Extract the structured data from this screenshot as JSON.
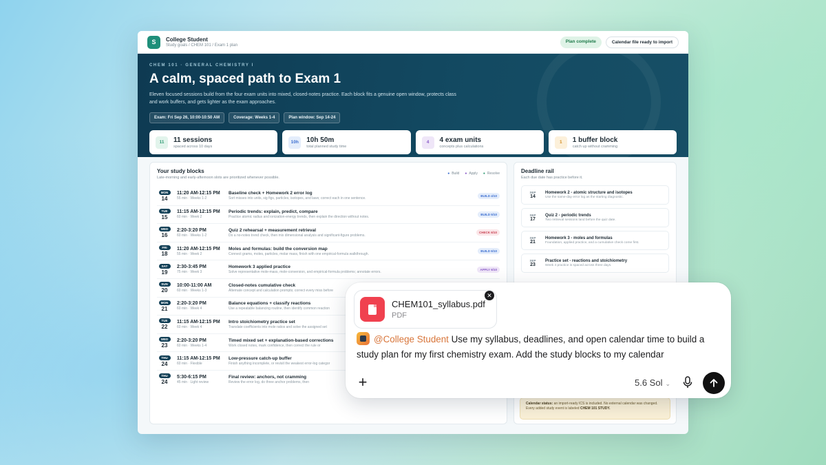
{
  "app": {
    "logo_letter": "S",
    "name": "College Student",
    "breadcrumb": "Study goals / CHEM 101 / Exam 1 plan",
    "status_pill": "Plan complete",
    "calendar_pill": "Calendar file ready to import"
  },
  "hero": {
    "eyebrow": "CHEM 101 · GENERAL CHEMISTRY I",
    "title": "A calm, spaced path to Exam 1",
    "description": "Eleven focused sessions build from the four exam units into mixed, closed-notes practice. Each block fits a genuine open window, protects class and work buffers, and gets lighter as the exam approaches.",
    "chips": [
      "Exam: Fri Sep 26, 10:00-10:50 AM",
      "Coverage: Weeks 1-4",
      "Plan window: Sep 14-24"
    ]
  },
  "stats": [
    {
      "badge": "11",
      "value": "11 sessions",
      "sub": "spaced across 10 days",
      "color": "#2f9a73",
      "bg": "#e2f4ec"
    },
    {
      "badge": "10h",
      "value": "10h 50m",
      "sub": "total planned study time",
      "color": "#3d6fd0",
      "bg": "#e4edfb"
    },
    {
      "badge": "4",
      "value": "4 exam units",
      "sub": "concepts plus calculations",
      "color": "#8a5cc8",
      "bg": "#efe6f8"
    },
    {
      "badge": "1",
      "value": "1 buffer block",
      "sub": "catch up without cramming",
      "color": "#d28a1e",
      "bg": "#fcf0da"
    }
  ],
  "blocks": {
    "title": "Your study blocks",
    "subtitle": "Late-morning and early-afternoon slots are prioritized whenever possible.",
    "legend": [
      "Build",
      "Apply",
      "Resolve"
    ],
    "rows": [
      {
        "dow": "MON",
        "day": "14",
        "time": "11:20 AM-12:15 PM",
        "meta": "55 min · Weeks 1-2",
        "title": "Baseline check + Homework 2 error log",
        "desc": "Sort misses into units, sig figs, particles, isotopes, and laws; correct each in one sentence.",
        "tag": "BUILD 4/10",
        "tag_kind": "build"
      },
      {
        "dow": "TUE",
        "day": "15",
        "time": "11:15 AM-12:15 PM",
        "meta": "60 min · Week 2",
        "title": "Periodic trends: explain, predict, compare",
        "desc": "Practice atomic radius and ionization-energy trends, then explain the direction without notes.",
        "tag": "BUILD 5/10",
        "tag_kind": "build"
      },
      {
        "dow": "WED",
        "day": "16",
        "time": "2:20-3:20 PM",
        "meta": "60 min · Weeks 1-2",
        "title": "Quiz 2 rehearsal + measurement retrieval",
        "desc": "Do a no-notes trend check, then mix dimensional analysis and significant-figure problems.",
        "tag": "CHECK 6/10",
        "tag_kind": "check"
      },
      {
        "dow": "FRI",
        "day": "18",
        "time": "11:20 AM-12:15 PM",
        "meta": "55 min · Week 2",
        "title": "Moles and formulas: build the conversion map",
        "desc": "Connect grams, moles, particles, molar mass, finish with one empirical-formula walkthrough.",
        "tag": "BUILD 6/10",
        "tag_kind": "build"
      },
      {
        "dow": "SAT",
        "day": "19",
        "time": "2:30-3:45 PM",
        "meta": "75 min · Week 3",
        "title": "Homework 3 applied practice",
        "desc": "Solve representative mole-mass, mole-conversion, and empirical-formula problems; annotate errors.",
        "tag": "APPLY 6/10",
        "tag_kind": "apply"
      },
      {
        "dow": "SUN",
        "day": "20",
        "time": "10:00-11:00 AM",
        "meta": "60 min · Weeks 1-3",
        "title": "Closed-notes cumulative check",
        "desc": "Alternate concept and calculation prompts; correct every miss before",
        "tag": "",
        "tag_kind": ""
      },
      {
        "dow": "MON",
        "day": "21",
        "time": "2:20-3:20 PM",
        "meta": "60 min · Week 4",
        "title": "Balance equations + classify reactions",
        "desc": "Use a repeatable balancing routine, then identify common reaction",
        "tag": "",
        "tag_kind": ""
      },
      {
        "dow": "TUE",
        "day": "22",
        "time": "11:15 AM-12:15 PM",
        "meta": "60 min · Week 4",
        "title": "Intro stoichiometry practice set",
        "desc": "Translate coefficients into mole ratios and solve the assigned set",
        "tag": "",
        "tag_kind": ""
      },
      {
        "dow": "WED",
        "day": "23",
        "time": "2:20-3:20 PM",
        "meta": "60 min · Weeks 1-4",
        "title": "Timed mixed set + explanation-based corrections",
        "desc": "Work closed notes, mark confidence, then correct the rule or",
        "tag": "",
        "tag_kind": ""
      },
      {
        "dow": "THU",
        "day": "24",
        "time": "11:15 AM-12:15 PM",
        "meta": "60 min · Flexible",
        "title": "Low-pressure catch-up buffer",
        "desc": "Finish anything incomplete, or revisit the weakest error-log categor",
        "tag": "",
        "tag_kind": ""
      },
      {
        "dow": "THU",
        "day": "24",
        "time": "5:30-6:15 PM",
        "meta": "45 min · Light review",
        "title": "Final review: anchors, not cramming",
        "desc": "Review the error log, do three anchor problems, then",
        "tag": "",
        "tag_kind": ""
      }
    ]
  },
  "rail": {
    "title": "Deadline rail",
    "subtitle": "Each due date has practice before it.",
    "items": [
      {
        "mon": "SEP",
        "day": "14",
        "title": "Homework 2 - atomic structure and isotopes",
        "desc": "Use the same-day error log as the starting diagnostic."
      },
      {
        "mon": "SEP",
        "day": "17",
        "title": "Quiz 2 - periodic trends",
        "desc": "Two retrieval sessions land before the quiz date."
      },
      {
        "mon": "SEP",
        "day": "21",
        "title": "Homework 3 - moles and formulas",
        "desc": "Foundation, applied practice, and a cumulative check come first."
      },
      {
        "mon": "SEP",
        "day": "23",
        "title": "Practice set - reactions and stoichiometry",
        "desc": "Week 4 practice is spaced across three days."
      }
    ],
    "status_label": "Calendar status:",
    "status_text": "an import-ready ICS is included. No external calendar was changed. Every added study event is labeled",
    "status_label_end": "CHEM 101 STUDY."
  },
  "composer": {
    "file_name": "CHEM101_syllabus.pdf",
    "file_type": "PDF",
    "remove_glyph": "✕",
    "mention": "@College Student",
    "prompt": " Use my syllabus, deadlines, and open calendar time to build a study plan for my first chemistry exam. Add the study blocks to my calendar",
    "plus_glyph": "+",
    "model": "5.6 Sol",
    "model_chevron": "⌄",
    "icons": {
      "attach": "plus-icon",
      "voice": "microphone-icon",
      "send": "arrow-up-icon",
      "file": "pdf-file-icon"
    }
  },
  "colors": {
    "hero_bg": "#0e3a52",
    "accent_green": "#1f8f7a",
    "mention": "#d8753a",
    "pdf": "#f0414f"
  }
}
